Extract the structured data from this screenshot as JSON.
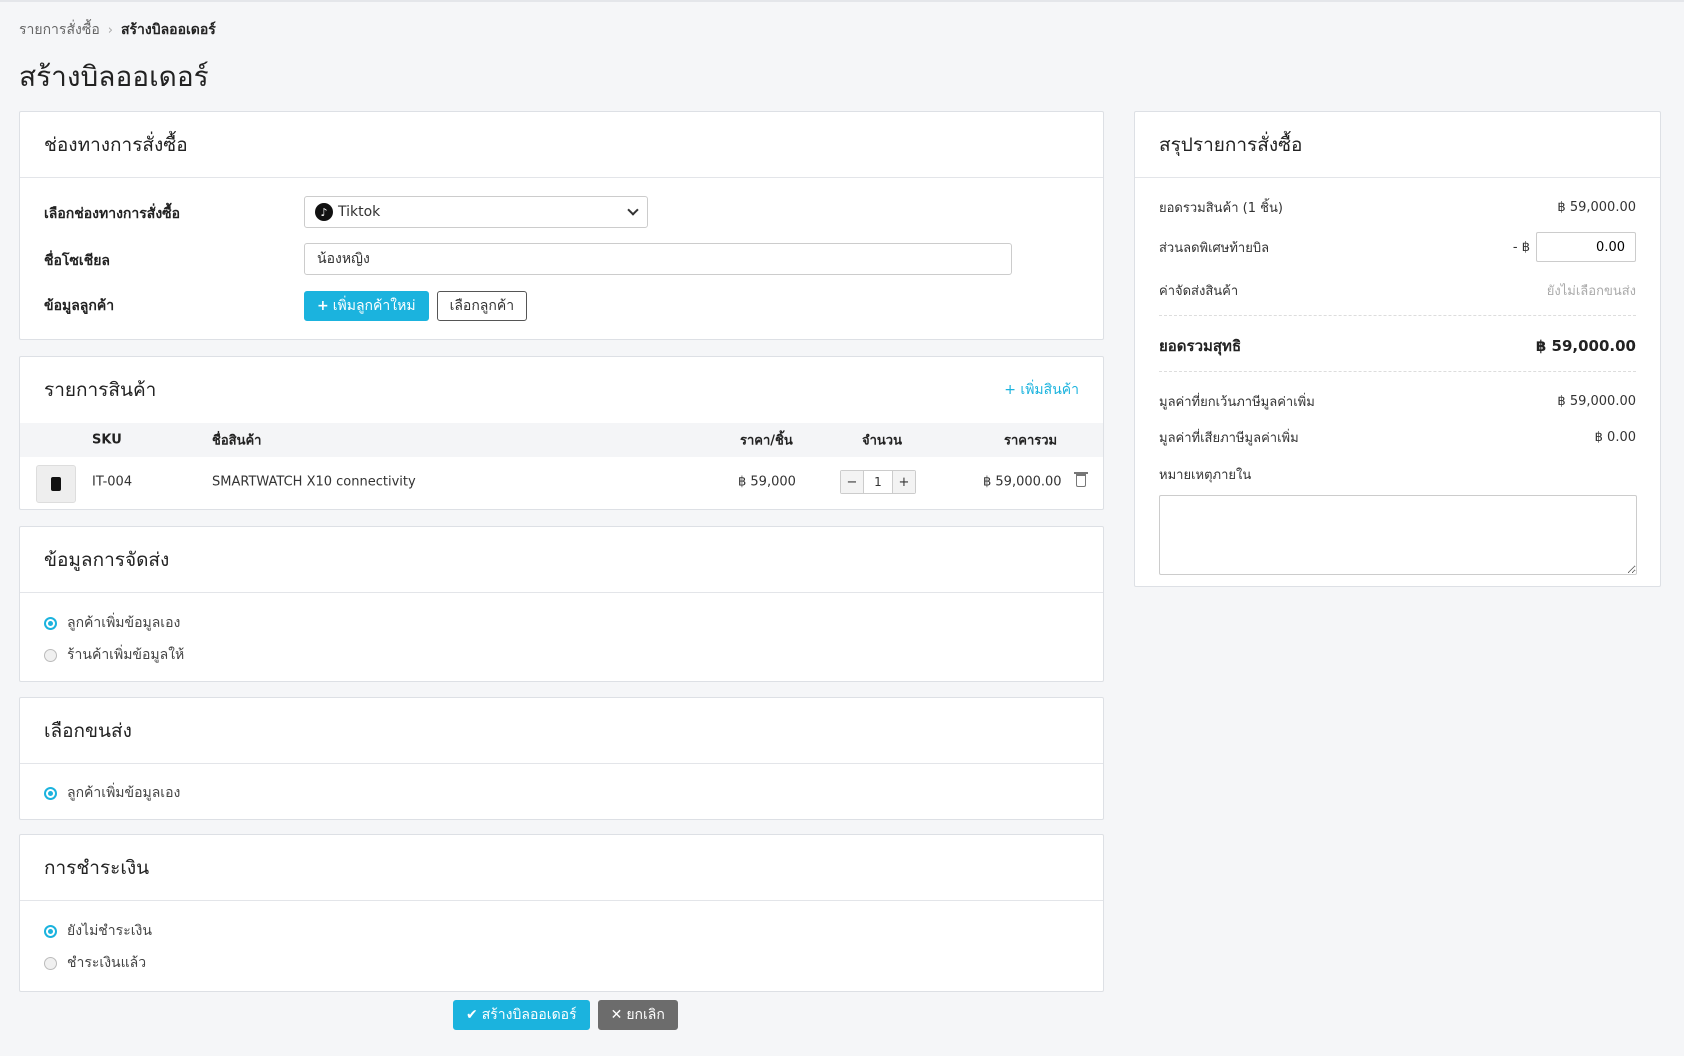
{
  "breadcrumb": {
    "parent": "รายการสั่งซื้อ",
    "separator": "›",
    "current": "สร้างบิลออเดอร์"
  },
  "page_title": "สร้างบิลออเดอร์",
  "channel": {
    "title": "ช่องทางการสั่งซื้อ",
    "channel_label": "เลือกช่องทางการสั่งซื้อ",
    "channel_value": "Tiktok",
    "social_label": "ชื่อโซเชียล",
    "social_value": "น้องหญิง",
    "customer_label": "ข้อมูลลูกค้า",
    "add_customer_button": "เพิ่มลูกค้าใหม่",
    "select_customer_button": "เลือกลูกค้า"
  },
  "products": {
    "title": "รายการสินค้า",
    "add_link": "+ เพิ่มสินค้า",
    "columns": {
      "sku": "SKU",
      "name": "ชื่อสินค้า",
      "price": "ราคา/ชิ้น",
      "qty": "จำนวน",
      "total": "ราคารวม"
    },
    "rows": [
      {
        "sku": "IT-004",
        "name": "SMARTWATCH X10 connectivity",
        "price": "฿ 59,000",
        "qty": "1",
        "total": "฿ 59,000.00"
      }
    ]
  },
  "shipping_info": {
    "title": "ข้อมูลการจัดส่ง",
    "options": [
      "ลูกค้าเพิ่มข้อมูลเอง",
      "ร้านค้าเพิ่มข้อมูลให้"
    ],
    "selected": 0
  },
  "carrier": {
    "title": "เลือกขนส่ง",
    "options": [
      "ลูกค้าเพิ่มข้อมูลเอง"
    ],
    "selected": 0
  },
  "payment": {
    "title": "การชำระเงิน",
    "options": [
      "ยังไม่ชำระเงิน",
      "ชำระเงินแล้ว"
    ],
    "selected": 0
  },
  "summary": {
    "title": "สรุปรายการสั่งซื้อ",
    "subtotal_label": "ยอดรวมสินค้า (1 ชิ้น)",
    "subtotal_value": "฿ 59,000.00",
    "discount_label": "ส่วนลดพิเศษท้ายบิล",
    "discount_prefix": "- ฿",
    "discount_value": "0.00",
    "shipping_label": "ค่าจัดส่งสินค้า",
    "shipping_value": "ยังไม่เลือกขนส่ง",
    "net_label": "ยอดรวมสุทธิ",
    "net_value": "฿ 59,000.00",
    "vat_exempt_label": "มูลค่าที่ยกเว้นภาษีมูลค่าเพิ่ม",
    "vat_exempt_value": "฿ 59,000.00",
    "vat_label": "มูลค่าที่เสียภาษีมูลค่าเพิ่ม",
    "vat_value": "฿ 0.00",
    "note_label": "หมายเหตุภายใน"
  },
  "actions": {
    "create": "สร้างบิลออเดอร์",
    "cancel": "ยกเลิก"
  },
  "colors": {
    "accent": "#1bb3de",
    "cancel": "#6c6c6c"
  }
}
